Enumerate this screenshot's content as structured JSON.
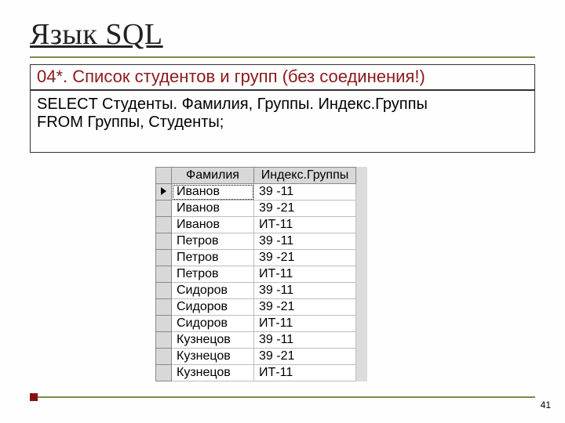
{
  "title": "Язык SQL",
  "subtitle": "04*. Список студентов и групп (без соединения!)",
  "code": "SELECT Студенты. Фамилия, Группы. Индекс.Группы\nFROM Группы, Студенты;",
  "grid": {
    "headers": [
      "Фамилия",
      "Индекс.Группы"
    ],
    "rows": [
      {
        "selected": true,
        "surname": "Иванов",
        "group": "39 -11"
      },
      {
        "selected": false,
        "surname": "Иванов",
        "group": "39 -21"
      },
      {
        "selected": false,
        "surname": "Иванов",
        "group": "ИТ-11"
      },
      {
        "selected": false,
        "surname": "Петров",
        "group": "39 -11"
      },
      {
        "selected": false,
        "surname": "Петров",
        "group": "39 -21"
      },
      {
        "selected": false,
        "surname": "Петров",
        "group": "ИТ-11"
      },
      {
        "selected": false,
        "surname": "Сидоров",
        "group": "39 -11"
      },
      {
        "selected": false,
        "surname": "Сидоров",
        "group": "39 -21"
      },
      {
        "selected": false,
        "surname": "Сидоров",
        "group": "ИТ-11"
      },
      {
        "selected": false,
        "surname": "Кузнецов",
        "group": "39 -11"
      },
      {
        "selected": false,
        "surname": "Кузнецов",
        "group": "39 -21"
      },
      {
        "selected": false,
        "surname": "Кузнецов",
        "group": "ИТ-11"
      }
    ]
  },
  "slide_number": "41"
}
